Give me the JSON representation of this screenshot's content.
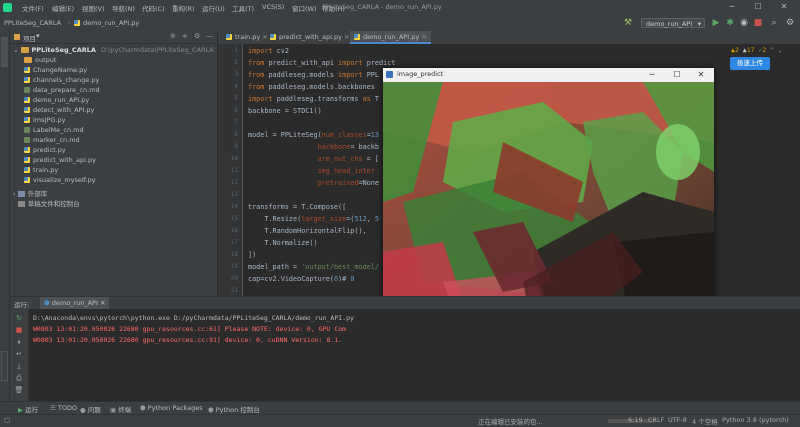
{
  "menu": [
    "文件(F)",
    "编辑(E)",
    "视图(V)",
    "导航(N)",
    "代码(C)",
    "重构(R)",
    "运行(U)",
    "工具(T)",
    "VCS(S)",
    "窗口(W)",
    "帮助(H)"
  ],
  "window_title": "PPLiteSeg_CARLA - demo_run_API.py",
  "breadcrumb": {
    "project": "PPLiteSeg_CARLA",
    "file": "demo_run_API.py"
  },
  "run_config": "demo_run_API",
  "project_panel": {
    "title": "项目",
    "root": "PPLiteSeg_CARLA",
    "root_path": "D:\\pyCharmdata\\PPLiteSeg_CARLA",
    "items": [
      {
        "name": "output",
        "kind": "folder"
      },
      {
        "name": "ChangeName.py",
        "kind": "py"
      },
      {
        "name": "channels_change.py",
        "kind": "py"
      },
      {
        "name": "data_prepare_cn.md",
        "kind": "md"
      },
      {
        "name": "demo_run_API.py",
        "kind": "py"
      },
      {
        "name": "detect_with_API.py",
        "kind": "py"
      },
      {
        "name": "imsJPG.py",
        "kind": "py"
      },
      {
        "name": "LabelMe_cn.md",
        "kind": "md"
      },
      {
        "name": "marker_cn.md",
        "kind": "md"
      },
      {
        "name": "predict.py",
        "kind": "py"
      },
      {
        "name": "predict_with_api.py",
        "kind": "py"
      },
      {
        "name": "train.py",
        "kind": "py"
      },
      {
        "name": "visualize_myself.py",
        "kind": "py"
      }
    ],
    "external_libs": "外部库",
    "scratches": "草稿文件和控制台"
  },
  "editor_tabs": [
    {
      "label": "train.py",
      "active": false
    },
    {
      "label": "predict_with_api.py",
      "active": false
    },
    {
      "label": "demo_run_API.py",
      "active": true
    }
  ],
  "inspection": {
    "warnings": "2",
    "weak": "17",
    "typos": "2"
  },
  "code_lines": [
    {
      "n": "1",
      "html": "<span class='kw'>import</span> cv2"
    },
    {
      "n": "2",
      "html": "<span class='kw'>from</span> predict_with_api <span class='kw'>import</span> predict"
    },
    {
      "n": "3",
      "html": "<span class='kw'>from</span> paddleseg.models <span class='kw'>import</span> PPL"
    },
    {
      "n": "4",
      "html": "<span class='kw'>from</span> paddleseg.models.backbones"
    },
    {
      "n": "5",
      "html": "<span class='kw'>import</span> paddleseg.transforms <span class='kw'>as</span> T"
    },
    {
      "n": "6",
      "html": "backbone = STDC1()"
    },
    {
      "n": "7",
      "html": ""
    },
    {
      "n": "8",
      "html": "model = PPLiteSeg(<span class='param'>num_classes</span>=<span class='num'>13</span>"
    },
    {
      "n": "9",
      "html": "                 <span class='param'>backbone</span>= backb"
    },
    {
      "n": "10",
      "html": "                 <span class='param'>arm_out_chs</span> = ["
    },
    {
      "n": "11",
      "html": "                 <span class='param'>seg_head_inter</span>"
    },
    {
      "n": "12",
      "html": "                 <span class='param'>pretrained</span>=None"
    },
    {
      "n": "13",
      "html": ""
    },
    {
      "n": "14",
      "html": "transforms = T.Compose(["
    },
    {
      "n": "15",
      "html": "    T.Resize(<span class='param'>target_size</span>=(<span class='num'>512</span>, <span class='num'>5</span>"
    },
    {
      "n": "16",
      "html": "    T.RandomHorizontalFlip(),"
    },
    {
      "n": "17",
      "html": "    T.Normalize()"
    },
    {
      "n": "18",
      "html": "])"
    },
    {
      "n": "19",
      "html": "model_path = <span class='str'>'output/best_model/</span>"
    },
    {
      "n": "20",
      "html": "cap=cv2.VideoCapture(<span class='num'>0</span>)# <span class='num'>0</span>"
    },
    {
      "n": "21",
      "html": ""
    }
  ],
  "image_window": {
    "title": "image_predict"
  },
  "cloud_button": "极速上传",
  "run_panel": {
    "label": "运行:",
    "tab": "demo_run_API",
    "lines": [
      {
        "text": "D:\\Anaconda\\envs\\pytorch\\python.exe D:/pyCharmdata/PPLiteSeg_CARLA/demo_run_API.py",
        "color": "#bbbbbb"
      },
      {
        "text": "W0803 13:01:20.050026 22680 gpu_resources.cc:61] Please NOTE: device: 0, GPU Com",
        "color": "#ff6b68"
      },
      {
        "text": "W0803 13:01:20.050026 22680 gpu_resources.cc:91] device: 0, cuDNN Version: 8.1.",
        "color": "#ff6b68"
      }
    ]
  },
  "bottom_tabs": [
    "运行",
    "TODO",
    "问题",
    "终端",
    "Python Packages",
    "Python 控制台"
  ],
  "status": {
    "message": "正在编辑已安装的包...",
    "position": "6:19",
    "line_sep": "CRLF",
    "encoding": "UTF-8",
    "indent": "4 个空格",
    "interpreter": "Python 3.8 (pytorch)"
  },
  "colors": {
    "accent": "#4a88c7",
    "error": "#ff6b68",
    "cloud": "#2f88e4"
  }
}
